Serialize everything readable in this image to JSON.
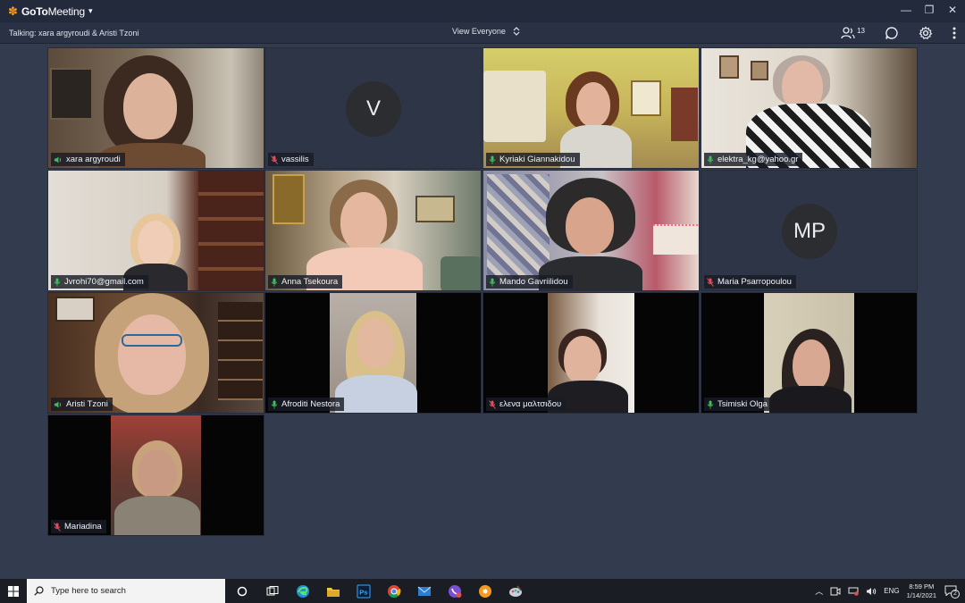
{
  "titlebar": {
    "app_name_bold": "GoTo",
    "app_name_light": "Meeting",
    "caret": "▾"
  },
  "toolbar": {
    "talking": "Talking: xara argyroudi & Aristi Tzoni",
    "view_label": "View Everyone",
    "attendee_count": "13"
  },
  "tiles": [
    {
      "name": "xara argyroudi",
      "status": "talking"
    },
    {
      "name": "vassilis",
      "status": "muted",
      "initials": "V"
    },
    {
      "name": "Kyriaki Giannakidou",
      "status": "mic"
    },
    {
      "name": "elektra_kg@yahoo.gr",
      "status": "mic"
    },
    {
      "name": "Jvrohi70@gmail.com",
      "status": "mic"
    },
    {
      "name": "Anna Tsekoura",
      "status": "mic"
    },
    {
      "name": "Mando Gavriilidou",
      "status": "mic"
    },
    {
      "name": "Maria Psarropoulou",
      "status": "muted",
      "initials": "MP"
    },
    {
      "name": "Aristi Tzoni",
      "status": "talking"
    },
    {
      "name": "Afroditi Nestora",
      "status": "mic"
    },
    {
      "name": "ελενα μαλτσιδου",
      "status": "muted"
    },
    {
      "name": "Tsimiski Olga",
      "status": "mic"
    },
    {
      "name": "Mariadina",
      "status": "muted"
    }
  ],
  "taskbar": {
    "search_placeholder": "Type here to search",
    "language": "ENG",
    "time": "8:59 PM",
    "date": "1/14/2021",
    "notification_count": "2"
  },
  "colors": {
    "accent_green": "#3fbf5a",
    "muted_red": "#e0505b",
    "brand_orange": "#f59a1f"
  }
}
